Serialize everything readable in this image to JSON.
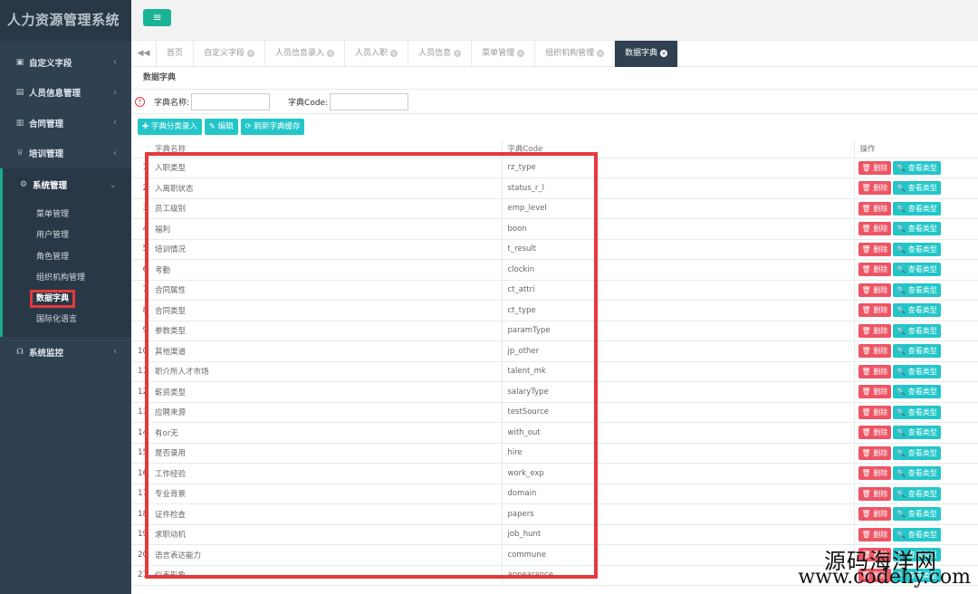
{
  "app": {
    "title": "人力资源管理系统"
  },
  "sidebar": {
    "items": [
      {
        "label": "自定义字段",
        "icon": "▣",
        "chev": "‹"
      },
      {
        "label": "人员信息管理",
        "icon": "▤",
        "chev": "‹"
      },
      {
        "label": "合同管理",
        "icon": "▥",
        "chev": "‹"
      },
      {
        "label": "培训管理",
        "icon": "♕",
        "chev": "‹"
      },
      {
        "label": "系统管理",
        "icon": "⚙",
        "chev": "⌄"
      },
      {
        "label": "系统监控",
        "icon": "☊",
        "chev": "‹"
      }
    ],
    "submenu": [
      "菜单管理",
      "用户管理",
      "角色管理",
      "组织机构管理",
      "数据字典",
      "国际化语言"
    ]
  },
  "topbar": {
    "menu_icon": "≡"
  },
  "tabs": {
    "nav_left": "◀◀",
    "items": [
      "首页",
      "自定义字段",
      "人员信息录入",
      "人员入职",
      "人员信息",
      "菜单管理",
      "组织机构管理",
      "数据字典"
    ],
    "close": "×"
  },
  "panel": {
    "title": "数据字典"
  },
  "search": {
    "name_label": "字典名称:",
    "code_label": "字典Code:",
    "warn": "!"
  },
  "toolbar": {
    "add": "✚ 字典分类录入",
    "edit": "✎ 编辑",
    "refresh": "⟳ 刷新字典缓存"
  },
  "table": {
    "headers": [
      "字典名称",
      "字典Code",
      "操作"
    ],
    "delete_label": "🗑 删除",
    "view_label": "🔍 查看类型",
    "rows": [
      {
        "idx": "1",
        "name": "入职类型",
        "code": "rz_type"
      },
      {
        "idx": "2",
        "name": "入离职状态",
        "code": "status_r_l"
      },
      {
        "idx": "3",
        "name": "员工级别",
        "code": "emp_level"
      },
      {
        "idx": "4",
        "name": "福利",
        "code": "boon"
      },
      {
        "idx": "5",
        "name": "培训情况",
        "code": "t_result"
      },
      {
        "idx": "6",
        "name": "考勤",
        "code": "clockin"
      },
      {
        "idx": "7",
        "name": "合同属性",
        "code": "ct_attri"
      },
      {
        "idx": "8",
        "name": "合同类型",
        "code": "ct_type"
      },
      {
        "idx": "9",
        "name": "参数类型",
        "code": "paramType"
      },
      {
        "idx": "10",
        "name": "其他渠道",
        "code": "jp_other"
      },
      {
        "idx": "11",
        "name": "职介所人才市场",
        "code": "talent_mk"
      },
      {
        "idx": "12",
        "name": "薪资类型",
        "code": "salaryType"
      },
      {
        "idx": "13",
        "name": "应聘来源",
        "code": "testSource"
      },
      {
        "idx": "14",
        "name": "有or无",
        "code": "with_out"
      },
      {
        "idx": "15",
        "name": "是否录用",
        "code": "hire"
      },
      {
        "idx": "16",
        "name": "工作经验",
        "code": "work_exp"
      },
      {
        "idx": "17",
        "name": "专业背景",
        "code": "domain"
      },
      {
        "idx": "18",
        "name": "证件检查",
        "code": "papers"
      },
      {
        "idx": "19",
        "name": "求职动机",
        "code": "job_hunt"
      },
      {
        "idx": "20",
        "name": "语言表达能力",
        "code": "commune"
      },
      {
        "idx": "21",
        "name": "仪表形象",
        "code": "appearance"
      }
    ]
  },
  "watermark": {
    "line1": "源码海洋网",
    "line2": "www.codehy.com"
  },
  "colors": {
    "sidebar": "#2f4050",
    "accent": "#1ab394",
    "info": "#23c6c8",
    "danger": "#ed5565",
    "highlight": "#e4393c"
  }
}
